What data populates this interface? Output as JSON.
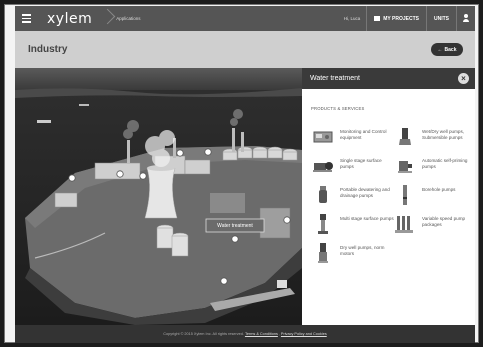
{
  "header": {
    "brand": "xylem",
    "applications_label": "Applications",
    "greeting": "Hi, Luca",
    "my_projects_label": "MY PROJECTS",
    "units_label": "UNITS"
  },
  "subheader": {
    "title": "Industry",
    "back_label": "Back"
  },
  "scene": {
    "hotspot_label": "Water treatment"
  },
  "panel": {
    "title": "Water treatment",
    "section_title": "PRODUCTS & SERVICES",
    "items": [
      {
        "label": "Monitoring and Control equipment",
        "icon": "control-panel-icon"
      },
      {
        "label": "Wet/Dry well pumps, Submersible pumps",
        "icon": "submersible-pump-icon"
      },
      {
        "label": "Single stage surface pumps",
        "icon": "surface-pump-icon"
      },
      {
        "label": "Automatic self-priming pumps",
        "icon": "self-priming-pump-icon"
      },
      {
        "label": "Portable dewatering and drainage pumps",
        "icon": "dewatering-pump-icon"
      },
      {
        "label": "Borehole pumps",
        "icon": "borehole-pump-icon"
      },
      {
        "label": "Multi stage surface pumps",
        "icon": "multistage-pump-icon"
      },
      {
        "label": "Variable speed pump packages",
        "icon": "pump-package-icon"
      },
      {
        "label": "Dry well pumps, norm motors",
        "icon": "dry-well-pump-icon"
      }
    ]
  },
  "footer": {
    "copyright": "Copyright © 2015 Xylem Inc. All rights reserved.",
    "terms_label": "Terms & Conditions",
    "separator": ",",
    "privacy_label": "Privacy Policy and Cookies"
  },
  "colors": {
    "nav_bg": "#555555",
    "subbar_bg": "#cfcfcf",
    "panel_head_bg": "#3a3a3a",
    "footer_bg": "#333333"
  }
}
